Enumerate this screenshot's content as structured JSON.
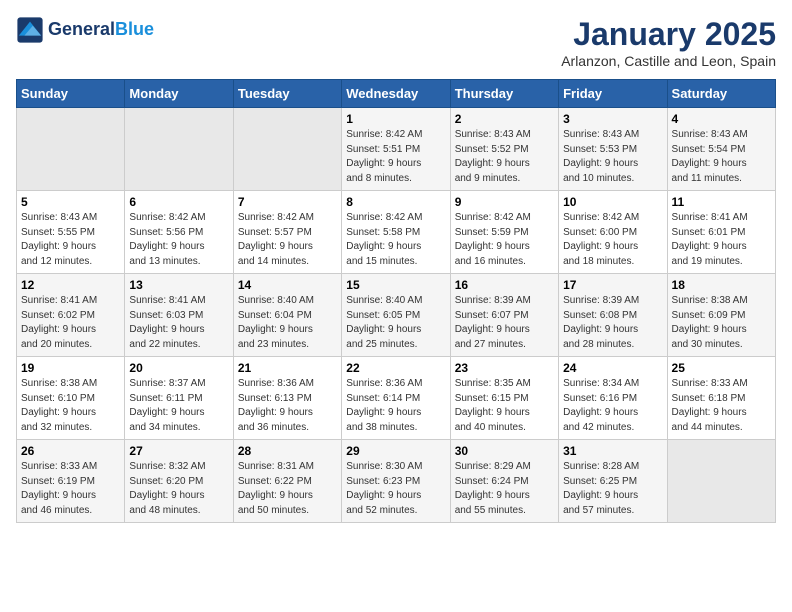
{
  "header": {
    "logo_line1": "General",
    "logo_line2": "Blue",
    "title": "January 2025",
    "subtitle": "Arlanzon, Castille and Leon, Spain"
  },
  "weekdays": [
    "Sunday",
    "Monday",
    "Tuesday",
    "Wednesday",
    "Thursday",
    "Friday",
    "Saturday"
  ],
  "weeks": [
    [
      {
        "num": "",
        "info": ""
      },
      {
        "num": "",
        "info": ""
      },
      {
        "num": "",
        "info": ""
      },
      {
        "num": "1",
        "info": "Sunrise: 8:42 AM\nSunset: 5:51 PM\nDaylight: 9 hours\nand 8 minutes."
      },
      {
        "num": "2",
        "info": "Sunrise: 8:43 AM\nSunset: 5:52 PM\nDaylight: 9 hours\nand 9 minutes."
      },
      {
        "num": "3",
        "info": "Sunrise: 8:43 AM\nSunset: 5:53 PM\nDaylight: 9 hours\nand 10 minutes."
      },
      {
        "num": "4",
        "info": "Sunrise: 8:43 AM\nSunset: 5:54 PM\nDaylight: 9 hours\nand 11 minutes."
      }
    ],
    [
      {
        "num": "5",
        "info": "Sunrise: 8:43 AM\nSunset: 5:55 PM\nDaylight: 9 hours\nand 12 minutes."
      },
      {
        "num": "6",
        "info": "Sunrise: 8:42 AM\nSunset: 5:56 PM\nDaylight: 9 hours\nand 13 minutes."
      },
      {
        "num": "7",
        "info": "Sunrise: 8:42 AM\nSunset: 5:57 PM\nDaylight: 9 hours\nand 14 minutes."
      },
      {
        "num": "8",
        "info": "Sunrise: 8:42 AM\nSunset: 5:58 PM\nDaylight: 9 hours\nand 15 minutes."
      },
      {
        "num": "9",
        "info": "Sunrise: 8:42 AM\nSunset: 5:59 PM\nDaylight: 9 hours\nand 16 minutes."
      },
      {
        "num": "10",
        "info": "Sunrise: 8:42 AM\nSunset: 6:00 PM\nDaylight: 9 hours\nand 18 minutes."
      },
      {
        "num": "11",
        "info": "Sunrise: 8:41 AM\nSunset: 6:01 PM\nDaylight: 9 hours\nand 19 minutes."
      }
    ],
    [
      {
        "num": "12",
        "info": "Sunrise: 8:41 AM\nSunset: 6:02 PM\nDaylight: 9 hours\nand 20 minutes."
      },
      {
        "num": "13",
        "info": "Sunrise: 8:41 AM\nSunset: 6:03 PM\nDaylight: 9 hours\nand 22 minutes."
      },
      {
        "num": "14",
        "info": "Sunrise: 8:40 AM\nSunset: 6:04 PM\nDaylight: 9 hours\nand 23 minutes."
      },
      {
        "num": "15",
        "info": "Sunrise: 8:40 AM\nSunset: 6:05 PM\nDaylight: 9 hours\nand 25 minutes."
      },
      {
        "num": "16",
        "info": "Sunrise: 8:39 AM\nSunset: 6:07 PM\nDaylight: 9 hours\nand 27 minutes."
      },
      {
        "num": "17",
        "info": "Sunrise: 8:39 AM\nSunset: 6:08 PM\nDaylight: 9 hours\nand 28 minutes."
      },
      {
        "num": "18",
        "info": "Sunrise: 8:38 AM\nSunset: 6:09 PM\nDaylight: 9 hours\nand 30 minutes."
      }
    ],
    [
      {
        "num": "19",
        "info": "Sunrise: 8:38 AM\nSunset: 6:10 PM\nDaylight: 9 hours\nand 32 minutes."
      },
      {
        "num": "20",
        "info": "Sunrise: 8:37 AM\nSunset: 6:11 PM\nDaylight: 9 hours\nand 34 minutes."
      },
      {
        "num": "21",
        "info": "Sunrise: 8:36 AM\nSunset: 6:13 PM\nDaylight: 9 hours\nand 36 minutes."
      },
      {
        "num": "22",
        "info": "Sunrise: 8:36 AM\nSunset: 6:14 PM\nDaylight: 9 hours\nand 38 minutes."
      },
      {
        "num": "23",
        "info": "Sunrise: 8:35 AM\nSunset: 6:15 PM\nDaylight: 9 hours\nand 40 minutes."
      },
      {
        "num": "24",
        "info": "Sunrise: 8:34 AM\nSunset: 6:16 PM\nDaylight: 9 hours\nand 42 minutes."
      },
      {
        "num": "25",
        "info": "Sunrise: 8:33 AM\nSunset: 6:18 PM\nDaylight: 9 hours\nand 44 minutes."
      }
    ],
    [
      {
        "num": "26",
        "info": "Sunrise: 8:33 AM\nSunset: 6:19 PM\nDaylight: 9 hours\nand 46 minutes."
      },
      {
        "num": "27",
        "info": "Sunrise: 8:32 AM\nSunset: 6:20 PM\nDaylight: 9 hours\nand 48 minutes."
      },
      {
        "num": "28",
        "info": "Sunrise: 8:31 AM\nSunset: 6:22 PM\nDaylight: 9 hours\nand 50 minutes."
      },
      {
        "num": "29",
        "info": "Sunrise: 8:30 AM\nSunset: 6:23 PM\nDaylight: 9 hours\nand 52 minutes."
      },
      {
        "num": "30",
        "info": "Sunrise: 8:29 AM\nSunset: 6:24 PM\nDaylight: 9 hours\nand 55 minutes."
      },
      {
        "num": "31",
        "info": "Sunrise: 8:28 AM\nSunset: 6:25 PM\nDaylight: 9 hours\nand 57 minutes."
      },
      {
        "num": "",
        "info": ""
      }
    ]
  ]
}
